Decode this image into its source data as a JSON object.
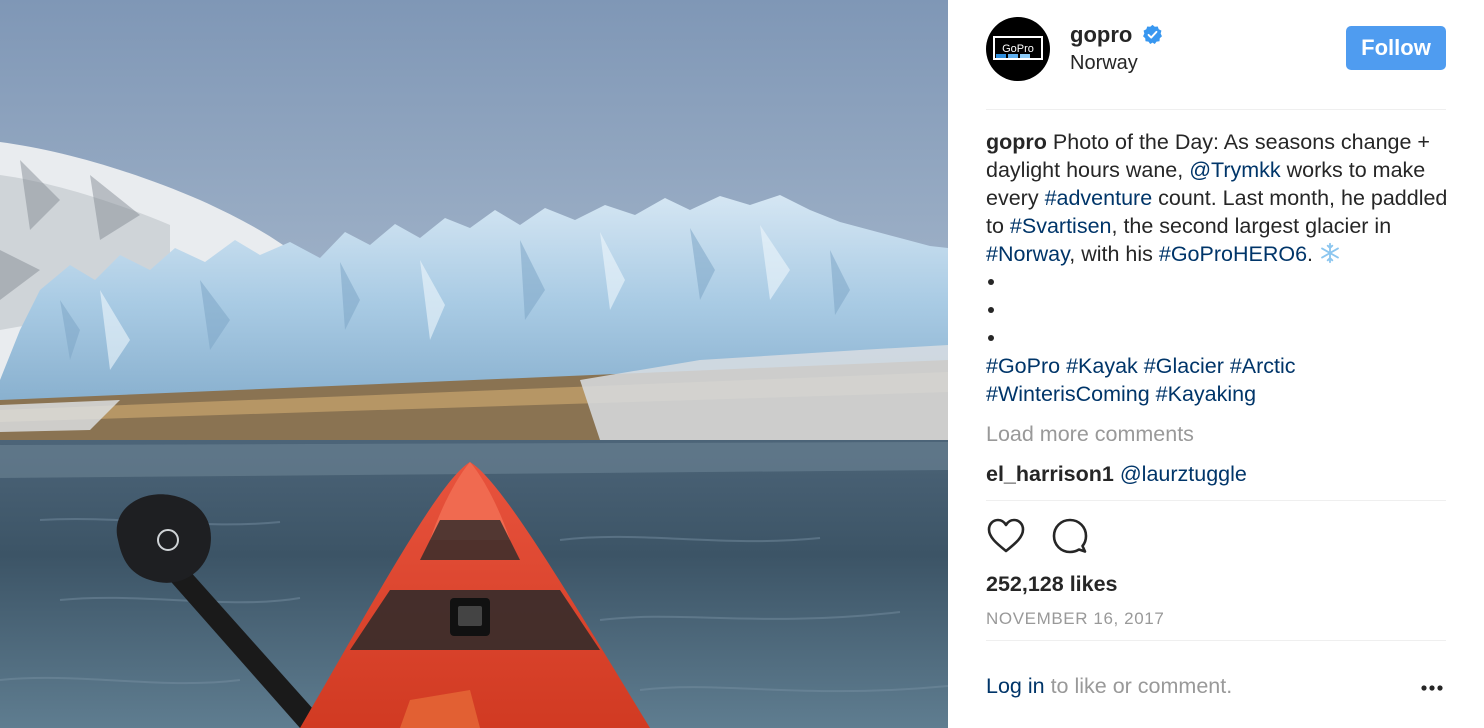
{
  "post": {
    "username": "gopro",
    "location": "Norway",
    "follow_label": "Follow",
    "avatar_text": "GoPro",
    "caption": {
      "user": "gopro",
      "t1": "Photo of the Day: As seasons change + daylight hours wane, ",
      "mention": "@Trymkk",
      "t2": " works to make every ",
      "tag_adventure": "#adventure",
      "t3": " count. Last month, he paddled to ",
      "tag_svartisen": "#Svartisen",
      "t4": ", the second largest glacier in ",
      "tag_norway": "#Norway",
      "t5": ", with his ",
      "tag_hero6": "#GoProHERO6",
      "t6": ". "
    },
    "hashtags": [
      "#GoPro",
      "#Kayak",
      "#Glacier",
      "#Arctic",
      "#WinterisComing",
      "#Kayaking"
    ],
    "load_more": "Load more comments",
    "next_comment_user": "el_harrison1",
    "next_comment_mention": "@laurztuggle",
    "likes": "252,128 likes",
    "date": "NOVEMBER 16, 2017",
    "login_link": "Log in",
    "login_rest": " to like or comment."
  },
  "icons": {
    "heart": "heart-icon",
    "comment": "comment-icon",
    "more": "more-options-icon",
    "verified": "verified-badge-icon",
    "snowflake": "snowflake-emoji"
  },
  "colors": {
    "follow_button": "#4f9cf0",
    "link": "#003569",
    "muted": "#999999",
    "text": "#262626"
  }
}
